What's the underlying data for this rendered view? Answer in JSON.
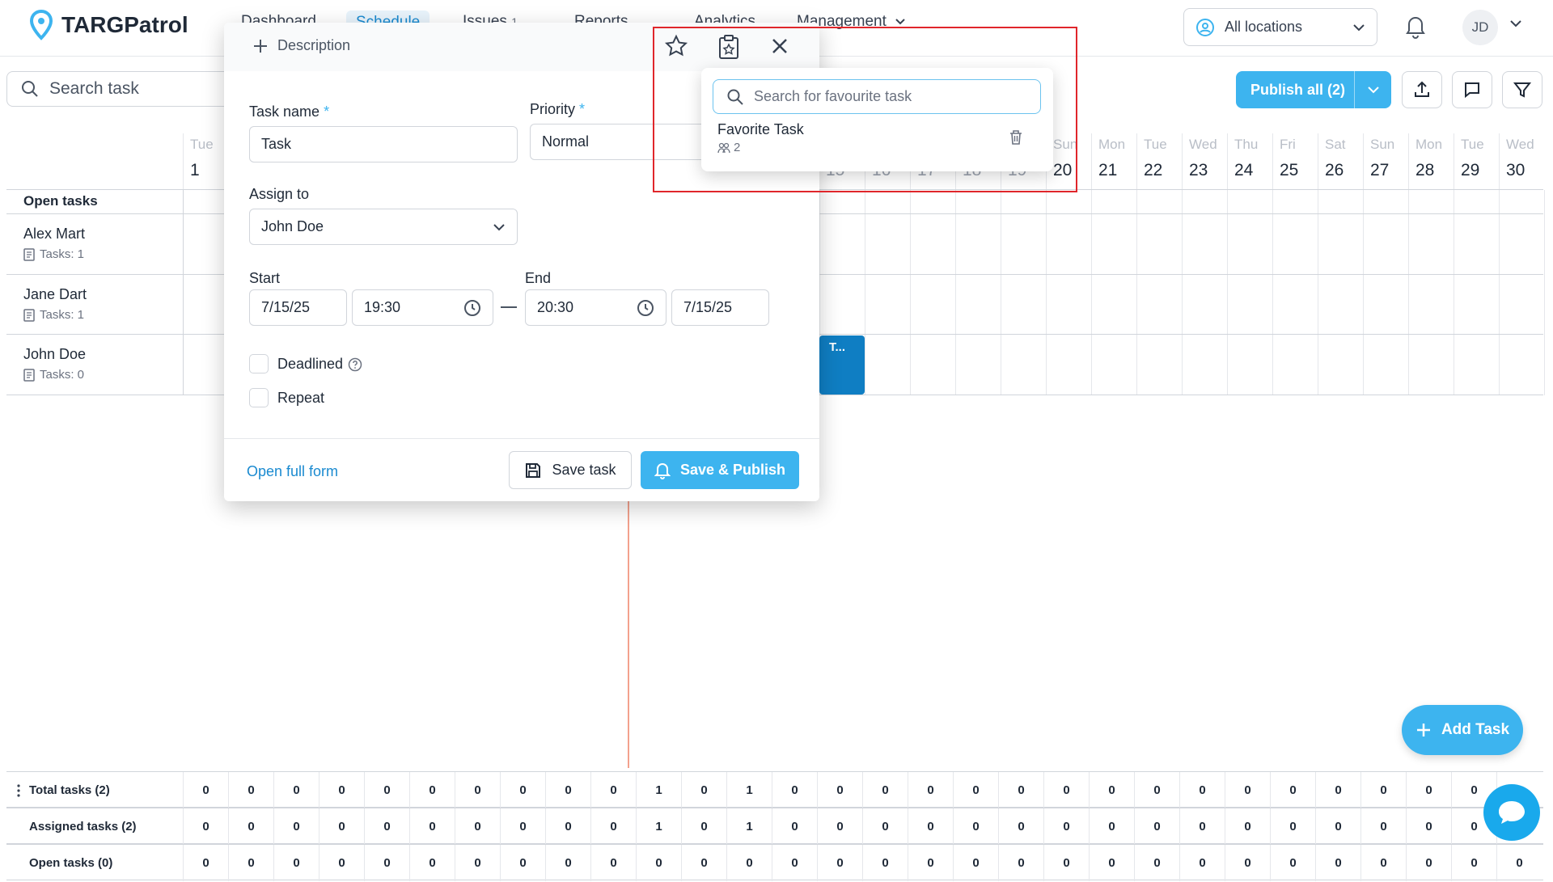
{
  "app": {
    "name": "TARGPatrol"
  },
  "nav": {
    "tabs": [
      "Dashboard",
      "Schedule",
      "Issues",
      "Reports",
      "Analytics",
      "Management"
    ],
    "issues_badge": "1",
    "location": "All locations",
    "user_initials": "JD"
  },
  "toolbar": {
    "search_placeholder": "Search task",
    "publish_label": "Publish all (2)"
  },
  "calendar": {
    "open_tasks_label": "Open tasks",
    "first_day": {
      "name": "Tue",
      "date": "1"
    },
    "partial_day": {
      "name": "Sun",
      "date": "20"
    },
    "hidden_dates": [
      "15",
      "16",
      "17",
      "18",
      "19"
    ],
    "days": [
      {
        "name": "Mon",
        "date": "21"
      },
      {
        "name": "Tue",
        "date": "22"
      },
      {
        "name": "Wed",
        "date": "23"
      },
      {
        "name": "Thu",
        "date": "24"
      },
      {
        "name": "Fri",
        "date": "25"
      },
      {
        "name": "Sat",
        "date": "26"
      },
      {
        "name": "Sun",
        "date": "27"
      },
      {
        "name": "Mon",
        "date": "28"
      },
      {
        "name": "Tue",
        "date": "29"
      },
      {
        "name": "Wed",
        "date": "30"
      }
    ],
    "rows": [
      {
        "name": "Alex Mart",
        "tasks": "Tasks: 1"
      },
      {
        "name": "Jane Dart",
        "tasks": "Tasks: 1"
      },
      {
        "name": "John Doe",
        "tasks": "Tasks: 0"
      }
    ],
    "task_block_label": "T..."
  },
  "summary": {
    "rows": [
      {
        "label": "Total tasks (2)",
        "values": [
          "0",
          "0",
          "0",
          "0",
          "0",
          "0",
          "0",
          "0",
          "0",
          "0",
          "1",
          "0",
          "1",
          "0",
          "0",
          "0",
          "0",
          "0",
          "0",
          "0",
          "0",
          "0",
          "0",
          "0",
          "0",
          "0",
          "0",
          "0",
          "0",
          "0"
        ]
      },
      {
        "label": "Assigned tasks (2)",
        "values": [
          "0",
          "0",
          "0",
          "0",
          "0",
          "0",
          "0",
          "0",
          "0",
          "0",
          "1",
          "0",
          "1",
          "0",
          "0",
          "0",
          "0",
          "0",
          "0",
          "0",
          "0",
          "0",
          "0",
          "0",
          "0",
          "0",
          "0",
          "0",
          "0",
          "0"
        ]
      },
      {
        "label": "Open tasks (0)",
        "values": [
          "0",
          "0",
          "0",
          "0",
          "0",
          "0",
          "0",
          "0",
          "0",
          "0",
          "0",
          "0",
          "0",
          "0",
          "0",
          "0",
          "0",
          "0",
          "0",
          "0",
          "0",
          "0",
          "0",
          "0",
          "0",
          "0",
          "0",
          "0",
          "0",
          "0"
        ]
      }
    ]
  },
  "add_task_label": "Add Task",
  "modal": {
    "description_label": "Description",
    "task_name_label": "Task name",
    "task_name_value": "Task",
    "priority_label": "Priority",
    "priority_value": "Normal",
    "assign_label": "Assign to",
    "assign_value": "John Doe",
    "start_label": "Start",
    "start_date": "7/15/25",
    "start_time": "19:30",
    "end_label": "End",
    "end_time": "20:30",
    "end_date": "7/15/25",
    "deadlined_label": "Deadlined",
    "repeat_label": "Repeat",
    "open_full_form": "Open full form",
    "save_task": "Save task",
    "save_publish": "Save & Publish"
  },
  "favorites": {
    "search_placeholder": "Search for favourite task",
    "items": [
      {
        "name": "Favorite Task",
        "count": "2"
      }
    ]
  },
  "colors": {
    "accent": "#3db4ef",
    "task_block": "#0f7ec3",
    "highlight": "#e0262b",
    "current_time_line": "#f3a18d"
  }
}
